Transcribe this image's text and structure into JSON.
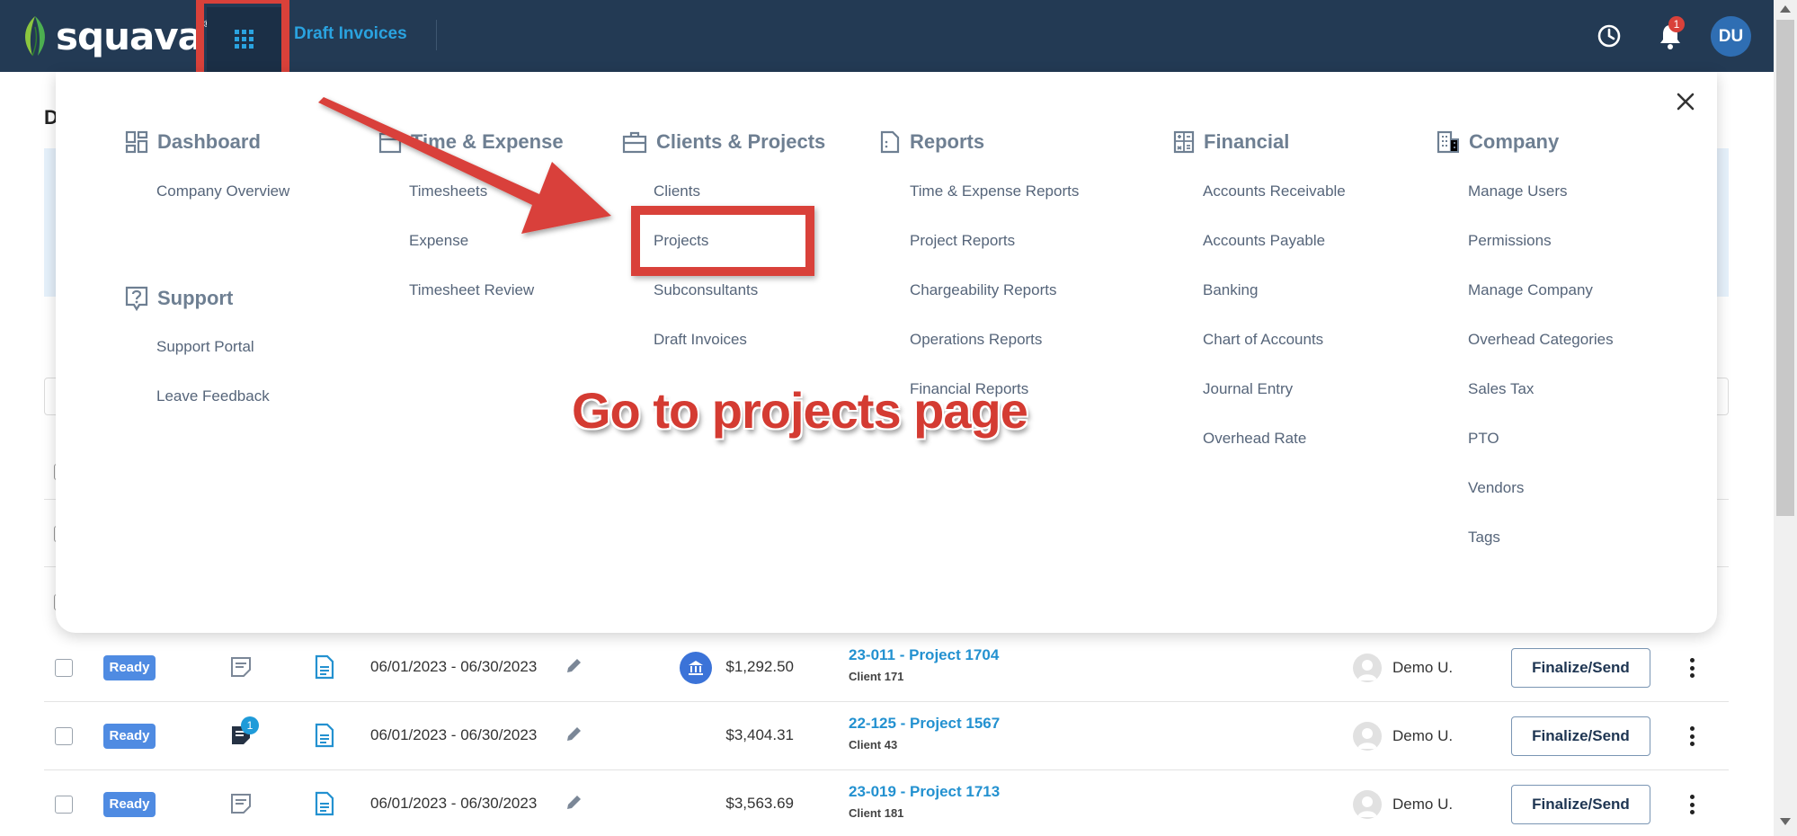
{
  "header": {
    "logo_text": "squava",
    "logo_reg": "®",
    "breadcrumb": "Draft Invoices",
    "notification_count": "1",
    "user_initials": "DU"
  },
  "background": {
    "title_initial": "D"
  },
  "menu": {
    "sections": {
      "dashboard": {
        "label": "Dashboard",
        "items": [
          "Company Overview"
        ]
      },
      "support": {
        "label": "Support",
        "items": [
          "Support Portal",
          "Leave Feedback"
        ]
      },
      "time_expense": {
        "label": "Time & Expense",
        "items": [
          "Timesheets",
          "Expense",
          "Timesheet Review"
        ]
      },
      "clients_projects": {
        "label": "Clients & Projects",
        "items": [
          "Clients",
          "Projects",
          "Subconsultants",
          "Draft Invoices"
        ]
      },
      "reports": {
        "label": "Reports",
        "items": [
          "Time & Expense Reports",
          "Project Reports",
          "Chargeability Reports",
          "Operations Reports",
          "Financial Reports"
        ]
      },
      "financial": {
        "label": "Financial",
        "items": [
          "Accounts Receivable",
          "Accounts Payable",
          "Banking",
          "Chart of Accounts",
          "Journal Entry",
          "Overhead Rate"
        ]
      },
      "company": {
        "label": "Company",
        "items": [
          "Manage Users",
          "Permissions",
          "Manage Company",
          "Overhead Categories",
          "Sales Tax",
          "PTO",
          "Vendors",
          "Tags"
        ]
      }
    }
  },
  "annotation": {
    "caption": "Go to projects page",
    "color": "#d9413a"
  },
  "rows": [
    {
      "status": "Ready",
      "period": "06/01/2023 - 06/30/2023",
      "amount": "$1,292.50",
      "project": "23-011 - Project 1704",
      "client": "Client 171",
      "user": "Demo U.",
      "action": "Finalize/Send",
      "has_bank": true,
      "note_count": ""
    },
    {
      "status": "Ready",
      "period": "06/01/2023 - 06/30/2023",
      "amount": "$3,404.31",
      "project": "22-125 - Project 1567",
      "client": "Client 43",
      "user": "Demo U.",
      "action": "Finalize/Send",
      "has_bank": false,
      "note_count": "1"
    },
    {
      "status": "Ready",
      "period": "06/01/2023 - 06/30/2023",
      "amount": "$3,563.69",
      "project": "23-019 - Project 1713",
      "client": "Client 181",
      "user": "Demo U.",
      "action": "Finalize/Send",
      "has_bank": false,
      "note_count": ""
    }
  ],
  "colors": {
    "topbar": "#233a54",
    "accent_link": "#2aa3e0",
    "status_ready": "#4f8be2"
  }
}
